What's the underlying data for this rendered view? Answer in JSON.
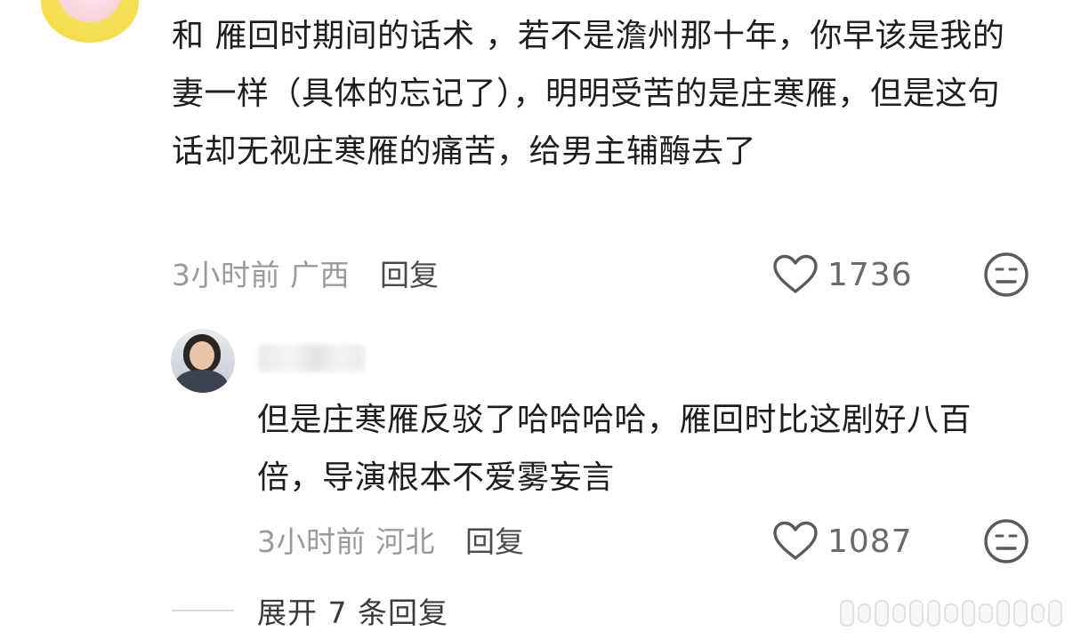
{
  "main_comment": {
    "text": "和 雁回时期间的话术 ，若不是澹州那十年，你早该是我的妻一样（具体的忘记了），明明受苦的是庄寒雁，但是这句话却无视庄寒雁的痛苦，给男主辅酶去了",
    "time_location": "3小时前 广西",
    "reply_label": "回复",
    "like_count": "1736"
  },
  "reply_comment": {
    "text": "但是庄寒雁反驳了哈哈哈哈，雁回时比这剧好八百倍，导演根本不爱雾妄言",
    "time_location": "3小时前 河北",
    "reply_label": "回复",
    "like_count": "1087"
  },
  "expand": {
    "label": "展开 7 条回复"
  },
  "icons": {
    "like": "heart-outline-icon",
    "reaction": "neutral-face-icon"
  },
  "colors": {
    "text_primary": "#1e1e1e",
    "text_meta": "#9a9a9a",
    "icon_gray": "#5a5a5a"
  }
}
